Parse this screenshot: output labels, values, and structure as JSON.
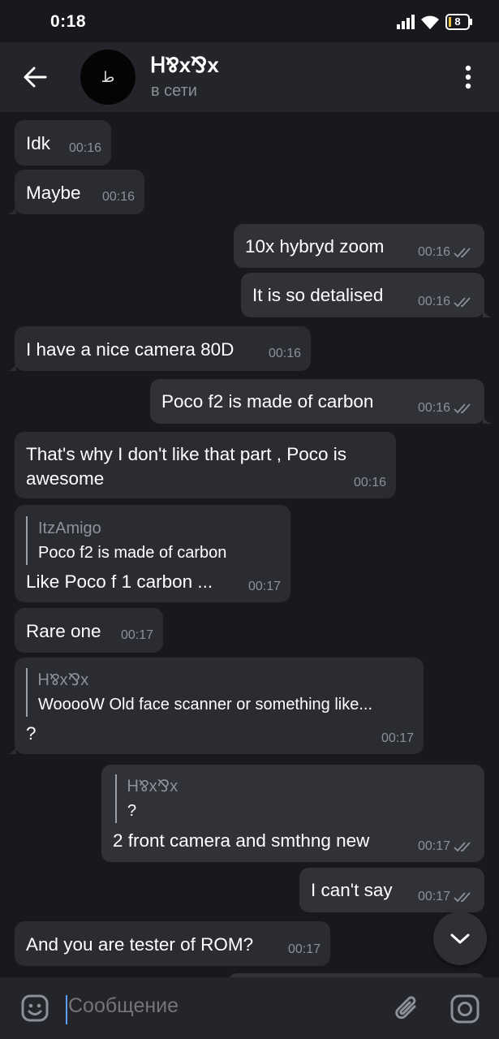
{
  "status_bar": {
    "time": "0:18",
    "battery": "8",
    "icons": [
      "signal-icon",
      "wifi-icon",
      "battery-icon"
    ]
  },
  "header": {
    "name": "Ꮋ⅋x⅋x",
    "status": "в сети",
    "icons": [
      "back-arrow-icon",
      "more-vert-icon"
    ]
  },
  "messages": [
    {
      "dir": "in",
      "text": "Idk",
      "time": "00:16"
    },
    {
      "dir": "in",
      "text": "Maybe",
      "time": "00:16"
    },
    {
      "dir": "out",
      "text": "10x hybryd zoom",
      "time": "00:16"
    },
    {
      "dir": "out",
      "text": "It is so detalised",
      "time": "00:16"
    },
    {
      "dir": "in",
      "text": "I have a nice camera 80D",
      "time": "00:16"
    },
    {
      "dir": "out",
      "text": "Poco f2 is made of carbon",
      "time": "00:16"
    },
    {
      "dir": "in",
      "text_line1": "That's why I don't like that part , Poco is",
      "text_line2": "awesome",
      "time": "00:16"
    },
    {
      "dir": "in",
      "reply_name": "ItzAmigo",
      "reply_text": "Poco f2 is made of carbon",
      "text": "Like Poco f 1 carbon ...",
      "time": "00:17"
    },
    {
      "dir": "in",
      "text": "Rare one",
      "time": "00:17"
    },
    {
      "dir": "in",
      "reply_name": "Ꮋ⅋x⅋x",
      "reply_text": "WooooW  Old face scanner or something like...",
      "text": "?",
      "time": "00:17"
    },
    {
      "dir": "out",
      "reply_name": "Ꮋ⅋x⅋x",
      "reply_text": "?",
      "text": "2 front camera and smthng new",
      "time": "00:17"
    },
    {
      "dir": "out",
      "text": "I can't say",
      "time": "00:17"
    },
    {
      "dir": "in",
      "text": "And you are tester of ROM?",
      "time": "00:17"
    }
  ],
  "composer": {
    "placeholder": "Сообщение",
    "icons": [
      "emoji-icon",
      "attach-icon",
      "camera-icon"
    ]
  },
  "scroll_down": {
    "icon": "chevron-down-icon"
  },
  "colors": {
    "background": "#18191d",
    "header": "#24252a",
    "bubble_in": "#2a2c31",
    "bubble_out": "#303238",
    "meta_text": "#8d9098",
    "cursor": "#5aa0ff"
  }
}
